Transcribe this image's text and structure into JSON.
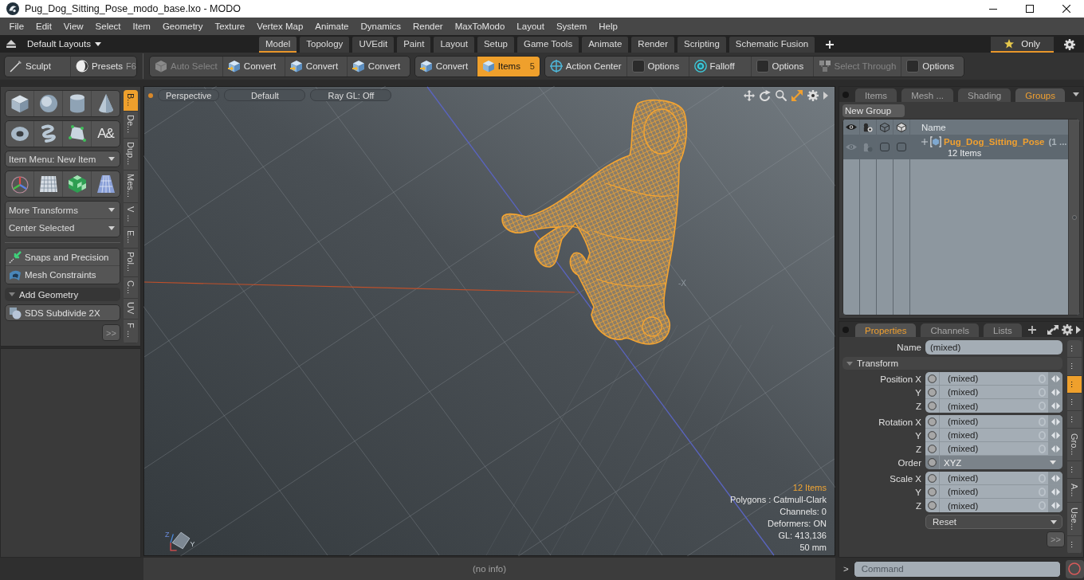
{
  "window": {
    "title": "Pug_Dog_Sitting_Pose_modo_base.lxo - MODO"
  },
  "menu": [
    "File",
    "Edit",
    "View",
    "Select",
    "Item",
    "Geometry",
    "Texture",
    "Vertex Map",
    "Animate",
    "Dynamics",
    "Render",
    "MaxToModo",
    "Layout",
    "System",
    "Help"
  ],
  "layout_bar": {
    "layouts": "Default Layouts",
    "tabs": [
      {
        "label": "Model",
        "selected": true
      },
      {
        "label": "Topology",
        "selected": false
      },
      {
        "label": "UVEdit",
        "selected": false
      },
      {
        "label": "Paint",
        "selected": false
      },
      {
        "label": "Layout",
        "selected": false
      },
      {
        "label": "Setup",
        "selected": false
      },
      {
        "label": "Game Tools",
        "selected": false
      },
      {
        "label": "Animate",
        "selected": false
      },
      {
        "label": "Render",
        "selected": false
      },
      {
        "label": "Scripting",
        "selected": false
      },
      {
        "label": "Schematic Fusion",
        "selected": false
      }
    ],
    "only_filter": {
      "label": "Only",
      "on": true
    }
  },
  "toolbar": {
    "left": [
      {
        "kind": "sculpt",
        "label": "Sculpt"
      },
      {
        "kind": "presets",
        "label": "Presets",
        "shortcut": "F6"
      }
    ],
    "groups": [
      [
        {
          "kind": "auto_select",
          "label": "Auto Select",
          "selected": false,
          "disabled": true
        },
        {
          "kind": "convert",
          "label": "Convert",
          "selected": false,
          "disabled": false
        },
        {
          "kind": "convert",
          "label": "Convert",
          "selected": false,
          "disabled": false
        },
        {
          "kind": "convert",
          "label": "Convert",
          "selected": false,
          "disabled": false
        }
      ],
      [
        {
          "kind": "convert",
          "label": "Convert",
          "selected": false,
          "disabled": false
        },
        {
          "kind": "items",
          "label": "Items",
          "shortcut": "5",
          "selected": true,
          "disabled": false
        }
      ],
      [
        {
          "kind": "action_center",
          "label": "Action Center",
          "selected": false,
          "disabled": false
        },
        {
          "kind": "options",
          "label": "Options",
          "selected": false,
          "disabled": false
        },
        {
          "kind": "falloff",
          "label": "Falloff",
          "selected": false,
          "disabled": false
        },
        {
          "kind": "options",
          "label": "Options",
          "selected": false,
          "disabled": false
        },
        {
          "kind": "select_through",
          "label": "Select Through",
          "selected": false,
          "disabled": true
        },
        {
          "kind": "options",
          "label": "Options",
          "selected": false,
          "disabled": false
        }
      ]
    ]
  },
  "left_panel": {
    "tool_rows": [
      [
        {
          "kind": "cube"
        },
        {
          "kind": "sphere"
        },
        {
          "kind": "cylinder"
        },
        {
          "kind": "cone"
        }
      ],
      [
        {
          "kind": "torus"
        },
        {
          "kind": "tube"
        },
        {
          "kind": "pen"
        },
        {
          "kind": "text",
          "glyph": "A&"
        }
      ]
    ],
    "item_menu": "Item Menu: New Item",
    "transform_tools": [
      {
        "kind": "transform"
      },
      {
        "kind": "mesh"
      },
      {
        "kind": "checker"
      },
      {
        "kind": "plane"
      }
    ],
    "dropdowns": [
      "More Transforms",
      "Center Selected"
    ],
    "buttons": [
      {
        "kind": "snap",
        "label": "Snaps and Precision"
      },
      {
        "kind": "constraints",
        "label": "Mesh Constraints"
      }
    ],
    "section": {
      "label": "Add Geometry",
      "expanded": true
    },
    "geometry_buttons": [
      {
        "kind": "sds",
        "label": "SDS Subdivide 2X"
      }
    ],
    "more": ">>",
    "tabs": [
      {
        "label": "B...",
        "selected": true
      },
      {
        "label": "De...",
        "selected": false
      },
      {
        "label": "Dup...",
        "selected": false
      },
      {
        "label": "Mes...",
        "selected": false
      },
      {
        "label": "V ...",
        "selected": false
      },
      {
        "label": "E...",
        "selected": false
      },
      {
        "label": "Pol...",
        "selected": false
      },
      {
        "label": "C...",
        "selected": false
      },
      {
        "label": "UV",
        "selected": false
      },
      {
        "label": "F ...",
        "selected": false
      }
    ]
  },
  "viewport": {
    "header": [
      "Perspective",
      "Default",
      "Ray GL: Off"
    ],
    "axis_label": "-X",
    "gizmo_labels": [
      "Z",
      "Y"
    ],
    "selection_info": "12 Items",
    "info_lines": [
      "Polygons : Catmull-Clark",
      "Channels: 0",
      "Deformers: ON",
      "GL: 413,136",
      "50 mm"
    ]
  },
  "groups_panel": {
    "tabs": [
      {
        "label": "Items",
        "selected": false
      },
      {
        "label": "Mesh ...",
        "selected": false
      },
      {
        "label": "Shading",
        "selected": false
      },
      {
        "label": "Groups",
        "selected": true
      }
    ],
    "new_group": "New Group",
    "name_column": "Name",
    "rows": [
      {
        "name": "Pug_Dog_Sitting_Pose",
        "count": "(1 ...",
        "subtitle": "12 Items",
        "expanded": false,
        "selected": true,
        "visible": true,
        "render": true,
        "locked": false,
        "column_4_checked": false
      }
    ]
  },
  "properties_panel": {
    "tabs": [
      {
        "label": "Properties",
        "selected": true
      },
      {
        "label": "Channels",
        "selected": false
      },
      {
        "label": "Lists",
        "selected": false
      }
    ],
    "name_label": "Name",
    "name_value": "(mixed)",
    "section": {
      "label": "Transform",
      "expanded": true
    },
    "field_groups": [
      [
        {
          "kind": "number",
          "label": "Position X",
          "value": "(mixed)"
        },
        {
          "kind": "number",
          "label": "Y",
          "value": "(mixed)"
        },
        {
          "kind": "number",
          "label": "Z",
          "value": "(mixed)"
        }
      ],
      [
        {
          "kind": "number",
          "label": "Rotation X",
          "value": "(mixed)"
        },
        {
          "kind": "number",
          "label": "Y",
          "value": "(mixed)"
        },
        {
          "kind": "number",
          "label": "Z",
          "value": "(mixed)"
        },
        {
          "kind": "dropdown",
          "label": "Order",
          "value": "XYZ"
        }
      ],
      [
        {
          "kind": "number",
          "label": "Scale X",
          "value": "(mixed)"
        },
        {
          "kind": "number",
          "label": "Y",
          "value": "(mixed)"
        },
        {
          "kind": "number",
          "label": "Z",
          "value": "(mixed)"
        }
      ]
    ],
    "reset": "Reset",
    "more": ">>",
    "side_tabs": [
      {
        "label": "...",
        "selected": false
      },
      {
        "label": "...",
        "selected": false
      },
      {
        "label": "...",
        "selected": true
      },
      {
        "label": "...",
        "selected": false
      },
      {
        "label": "...",
        "selected": false
      },
      {
        "label": "Gro...",
        "selected": false
      },
      {
        "label": "...",
        "selected": false
      },
      {
        "label": "A...",
        "selected": false
      },
      {
        "label": "Use...",
        "selected": false
      },
      {
        "label": "...",
        "selected": false
      }
    ]
  },
  "status_bar": {
    "info": "(no info)",
    "prompt": ">",
    "command_placeholder": "Command"
  }
}
